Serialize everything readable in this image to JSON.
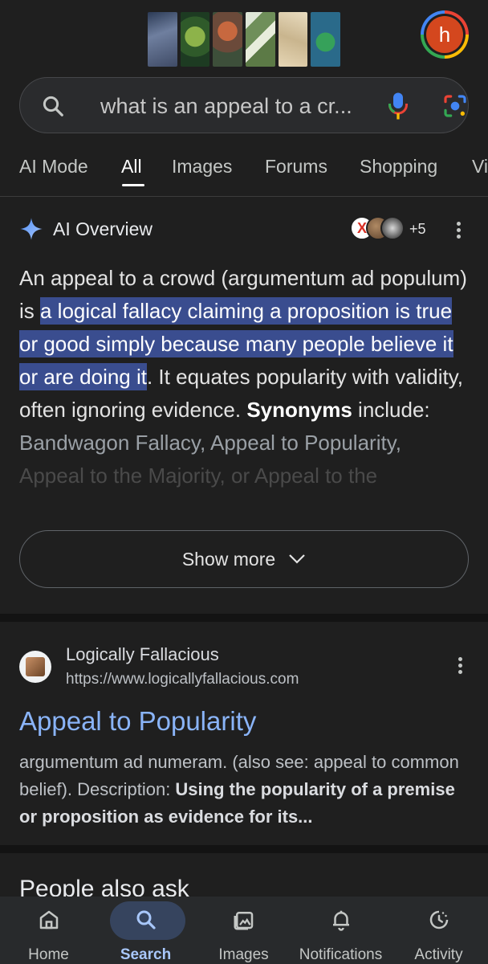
{
  "header": {
    "avatar_letter": "h",
    "doodle_alt": "",
    "avatar_color": "#d4471e"
  },
  "search": {
    "query": "what is an appeal to a cr..."
  },
  "tabs": [
    {
      "label": "AI Mode",
      "active": false
    },
    {
      "label": "All",
      "active": true
    },
    {
      "label": "Images",
      "active": false
    },
    {
      "label": "Forums",
      "active": false
    },
    {
      "label": "Shopping",
      "active": false
    },
    {
      "label": "Vi",
      "active": false
    }
  ],
  "ai_overview": {
    "title": "AI Overview",
    "sources_more": "+5",
    "body": {
      "p1": "An appeal to a crowd (argumentum ad populum) is ",
      "highlight": "a logical fallacy claiming a proposition is true or good simply because many people believe it or are doing it",
      "p2": ". It equates popularity with validity, often ignoring evidence. ",
      "bold": "Synonyms",
      "p3": " include: ",
      "fade1": "Bandwagon Fallacy, Appeal to Popularity,",
      "fade2": "Appeal to the Majority, or Appeal to the"
    },
    "show_more": "Show more"
  },
  "result": {
    "site": "Logically Fallacious",
    "url": "https://www.logicallyfallacious.com",
    "title": "Appeal to Popularity",
    "snippet_plain": "argumentum ad numeram. (also see: appeal to common belief). Description: ",
    "snippet_bold": "Using the popularity of a premise or proposition as evidence for its..."
  },
  "people_also_ask": "People also ask",
  "bottom_nav": [
    {
      "label": "Home",
      "icon": "home-icon",
      "active": false
    },
    {
      "label": "Search",
      "icon": "search-icon",
      "active": true
    },
    {
      "label": "Images",
      "icon": "images-icon",
      "active": false
    },
    {
      "label": "Notifications",
      "icon": "bell-icon",
      "active": false
    },
    {
      "label": "Activity",
      "icon": "activity-icon",
      "active": false
    }
  ],
  "colors": {
    "background": "#1f1f1f",
    "link": "#8ab4f8",
    "highlight": "#3a4d8f",
    "active_nav": "#a8c7fa"
  }
}
